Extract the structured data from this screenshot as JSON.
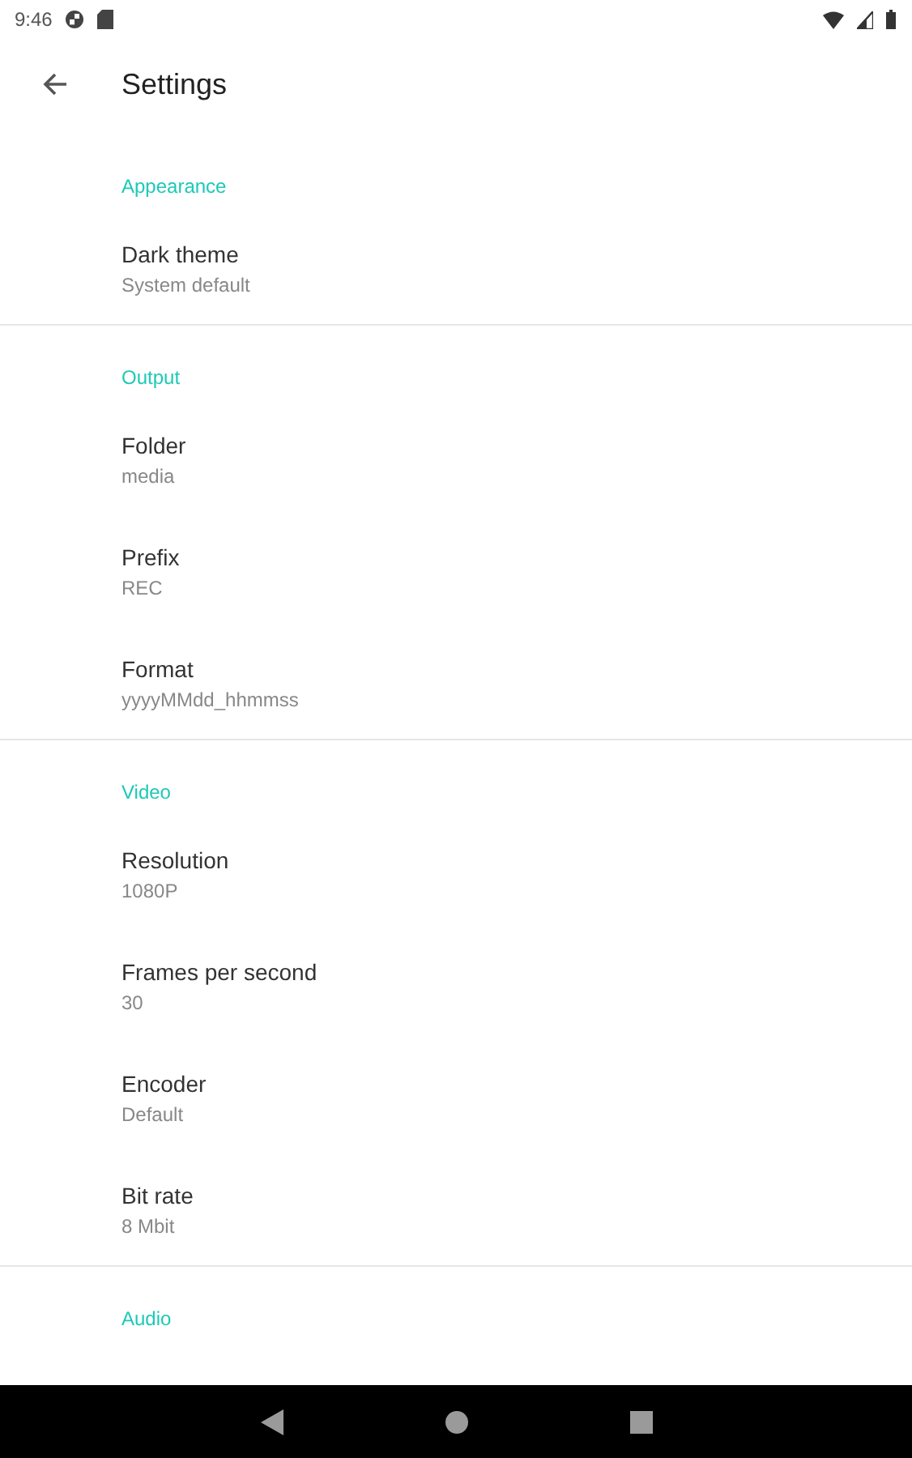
{
  "status_bar": {
    "time": "9:46"
  },
  "toolbar": {
    "title": "Settings"
  },
  "categories": [
    {
      "title": "Appearance",
      "items": [
        {
          "title": "Dark theme",
          "summary": "System default"
        }
      ]
    },
    {
      "title": "Output",
      "items": [
        {
          "title": "Folder",
          "summary": "media"
        },
        {
          "title": "Prefix",
          "summary": "REC"
        },
        {
          "title": "Format",
          "summary": "yyyyMMdd_hhmmss"
        }
      ]
    },
    {
      "title": "Video",
      "items": [
        {
          "title": "Resolution",
          "summary": "1080P"
        },
        {
          "title": "Frames per second",
          "summary": "30"
        },
        {
          "title": "Encoder",
          "summary": "Default"
        },
        {
          "title": "Bit rate",
          "summary": "8 Mbit"
        }
      ]
    },
    {
      "title": "Audio"
    }
  ]
}
